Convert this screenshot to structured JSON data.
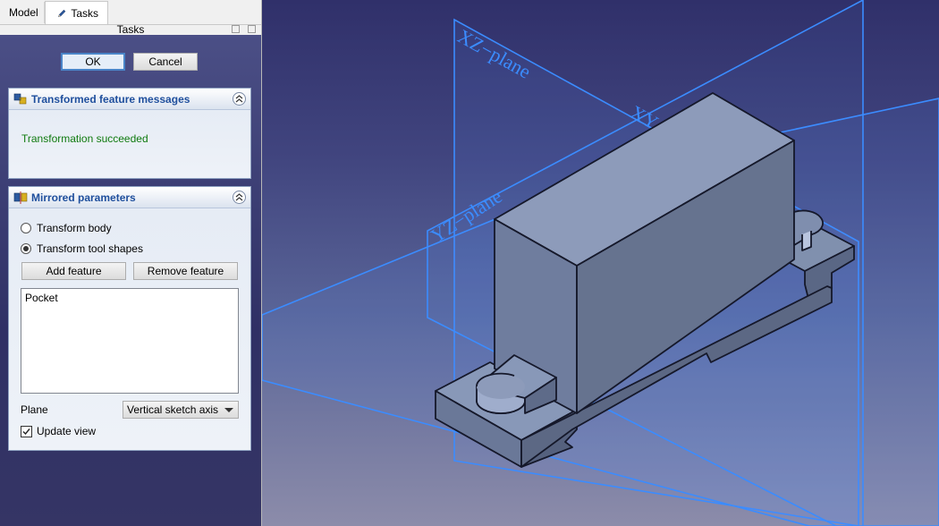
{
  "tabs": [
    {
      "label": "Model"
    },
    {
      "label": "Tasks"
    }
  ],
  "dock": {
    "title": "Tasks"
  },
  "dialog": {
    "ok_label": "OK",
    "cancel_label": "Cancel"
  },
  "messages_panel": {
    "title": "Transformed feature messages",
    "message": "Transformation succeeded",
    "message_color": "#0f7a0f"
  },
  "params_panel": {
    "title": "Mirrored parameters",
    "radio_transform_body": "Transform body",
    "radio_transform_tool": "Transform tool shapes",
    "selected_radio": "Transform tool shapes",
    "add_feature_label": "Add feature",
    "remove_feature_label": "Remove feature",
    "features": [
      "Pocket"
    ],
    "plane_label": "Plane",
    "plane_value": "Vertical sketch axis",
    "update_view_label": "Update view",
    "update_view_checked": true
  },
  "viewport": {
    "plane_labels": {
      "xz": "XZ−plane",
      "xy": "XY−plane",
      "yz": "YZ−plane"
    },
    "plane_color": "#3b8cff",
    "part_color": "#6e7fa0"
  }
}
